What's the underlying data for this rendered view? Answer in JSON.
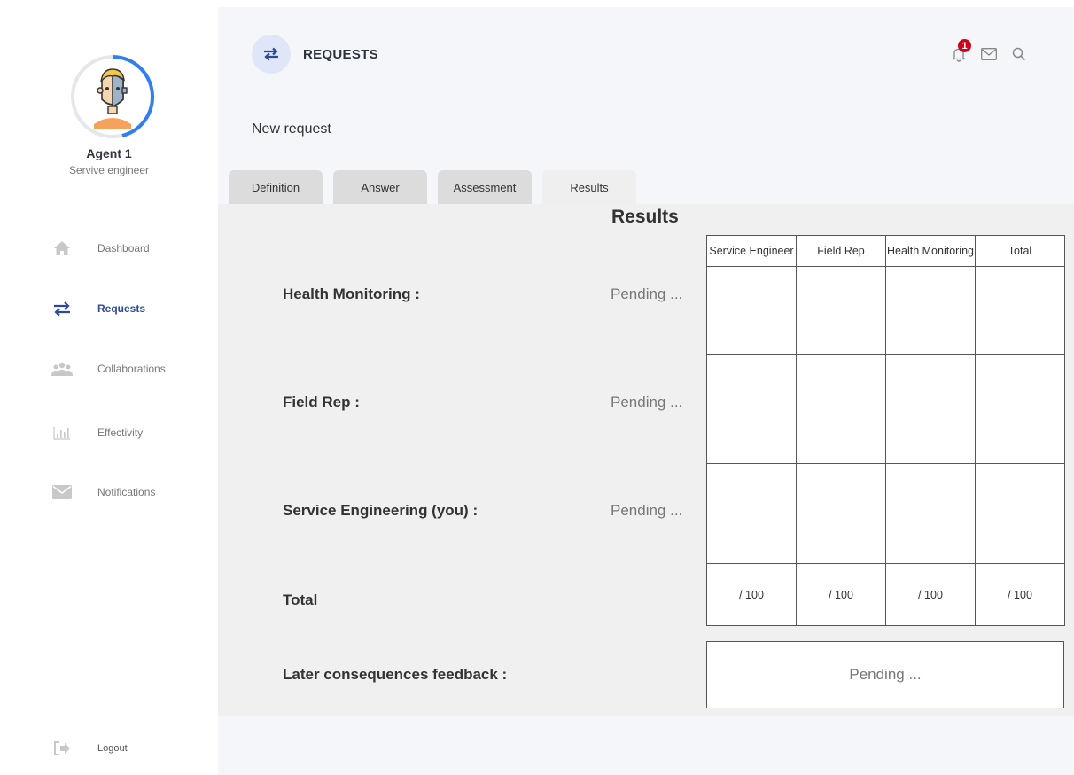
{
  "agent": {
    "name": "Agent 1",
    "role": "Servive engineer"
  },
  "nav": {
    "items": [
      {
        "label": "Dashboard",
        "icon": "home-icon"
      },
      {
        "label": "Requests",
        "icon": "transfer-arrows-icon",
        "active": true
      },
      {
        "label": "Collaborations",
        "icon": "group-icon"
      },
      {
        "label": "Effectivity",
        "icon": "bar-chart-icon"
      },
      {
        "label": "Notifications",
        "icon": "envelope-icon"
      }
    ],
    "logout": "Logout"
  },
  "header": {
    "title": "REQUESTS",
    "notification_count": "1",
    "subtitle": "New request"
  },
  "tabs": [
    {
      "label": "Definition"
    },
    {
      "label": "Answer"
    },
    {
      "label": "Assessment"
    },
    {
      "label": "Results",
      "active": true
    }
  ],
  "results": {
    "title": "Results",
    "rows": [
      {
        "label": "Health Monitoring :",
        "status": "Pending ..."
      },
      {
        "label": "Field Rep :",
        "status": "Pending ..."
      },
      {
        "label": "Service Engineering (you) :",
        "status": "Pending ..."
      }
    ],
    "total_label": "Total",
    "feedback_label": "Later consequences feedback :",
    "feedback_status": "Pending ...",
    "table": {
      "columns": [
        "Service Engineer",
        "Field Rep",
        "Health Monitoring",
        "Total"
      ],
      "totals": [
        "/ 100",
        "/ 100",
        "/ 100",
        "/ 100"
      ]
    }
  },
  "colors": {
    "accent": "#2d4a9a",
    "avatar_ring": "#2f80ed",
    "badge": "#d0021b",
    "panel": "#f0f0f0"
  }
}
